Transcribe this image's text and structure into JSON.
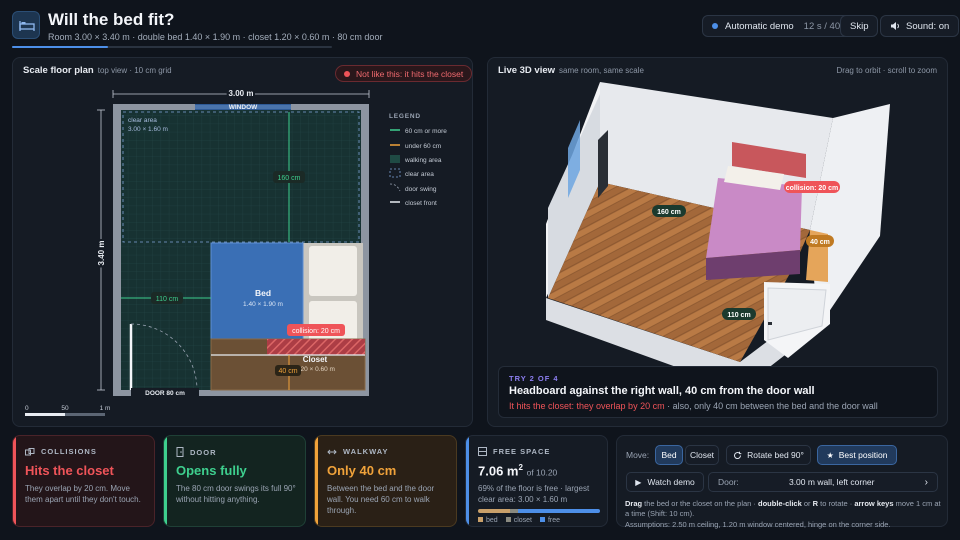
{
  "header": {
    "title": "Will the bed fit?",
    "subtitle": "Room 3.00 × 3.40 m · double bed 1.40 × 1.90 m · closet 1.20 × 0.60 m · 80 cm door",
    "demo_progress": 0.3,
    "demo_label": "Automatic demo",
    "demo_time": "12 s / 40 s",
    "skip_label": "Skip",
    "sound_label": "Sound: on"
  },
  "plan": {
    "title": "Scale floor plan",
    "sub": "top view · 10 cm grid",
    "warning": "Not like this: it hits the closet",
    "width_label": "3.00 m",
    "height_label": "3.40 m",
    "window_label": "WINDOW",
    "clear_area_title": "clear area",
    "clear_area_size": "3.00 × 1.60 m",
    "dim_160": "160 cm",
    "dim_110": "110 cm",
    "dim_40": "40 cm",
    "bed_label": "Bed",
    "bed_size": "1.40 × 1.90 m",
    "closet_label": "Closet",
    "closet_size": "1.20 × 0.60 m",
    "collision_label": "collision: 20 cm",
    "door_label": "DOOR 80 cm",
    "scale_0": "0",
    "scale_50": "50",
    "scale_1m": "1 m",
    "legend_title": "LEGEND",
    "legend": [
      {
        "label": "60 cm or more",
        "color": "#3ecf8e"
      },
      {
        "label": "under 60 cm",
        "color": "#f0a23a"
      },
      {
        "label": "walking area",
        "color": "#1f4a44"
      },
      {
        "label": "clear area",
        "color": "#7fa3d8"
      },
      {
        "label": "door swing",
        "color": "#9aa4b3"
      },
      {
        "label": "closet front",
        "color": "#e8ecf2"
      }
    ]
  },
  "view3d": {
    "title": "Live 3D view",
    "sub": "same room, same scale",
    "hint": "Drag to orbit · scroll to zoom",
    "label_160": "160 cm",
    "label_110": "110 cm",
    "label_40": "40 cm",
    "label_collision": "collision: 20 cm"
  },
  "try": {
    "tag": "TRY 2 OF 4",
    "title": "Headboard against the right wall, 40 cm from the door wall",
    "text_red": "It hits the closet: they overlap by 20 cm",
    "text_rest": " · also, only 40 cm between the bed and the door wall"
  },
  "cards": {
    "collisions": {
      "label": "COLLISIONS",
      "value": "Hits the closet",
      "desc": "They overlap by 20 cm. Move them apart until they don't touch.",
      "color": "#ef5459"
    },
    "door": {
      "label": "DOOR",
      "value": "Opens fully",
      "desc": "The 80 cm door swings its full 90° without hitting anything.",
      "color": "#3ecf8e"
    },
    "walkway": {
      "label": "WALKWAY",
      "value": "Only 40 cm",
      "desc": "Between the bed and the door wall. You need 60 cm to walk through.",
      "color": "#f0a23a"
    },
    "free": {
      "label": "FREE SPACE",
      "value": "7.06 m",
      "sup": "2",
      "of": "of 10.20",
      "desc": "69% of the floor is free · largest clear area: 3.00 × 1.60 m",
      "color": "#4d8fe8",
      "legend_bed": "bed",
      "legend_closet": "closet",
      "legend_free": "free",
      "share_bed": 0.26,
      "share_closet": 0.07,
      "share_free": 0.67
    }
  },
  "controls": {
    "move_label": "Move:",
    "bed_btn": "Bed",
    "closet_btn": "Closet",
    "rotate_btn": "Rotate bed 90°",
    "best_btn": "Best position",
    "watch_btn": "Watch demo",
    "door_label": "Door:",
    "door_value": "3.00 m wall, left corner",
    "help_1": "Drag",
    "help_2": " the bed or the closet on the plan · ",
    "help_3": "double-click",
    "help_4": " or ",
    "help_5": "R",
    "help_6": " to rotate · ",
    "help_7": "arrow keys",
    "help_8": " move 1 cm at a time (Shift: 10 cm).",
    "assumptions": "Assumptions: 2.50 m ceiling, 1.20 m window centered, hinge on the corner side."
  },
  "colors": {
    "accent": "#4d8fe8",
    "bed": "#3a6fb5",
    "closet": "#6b5035",
    "danger": "#ef5459",
    "ok": "#3ecf8e",
    "warn": "#f0a23a"
  }
}
